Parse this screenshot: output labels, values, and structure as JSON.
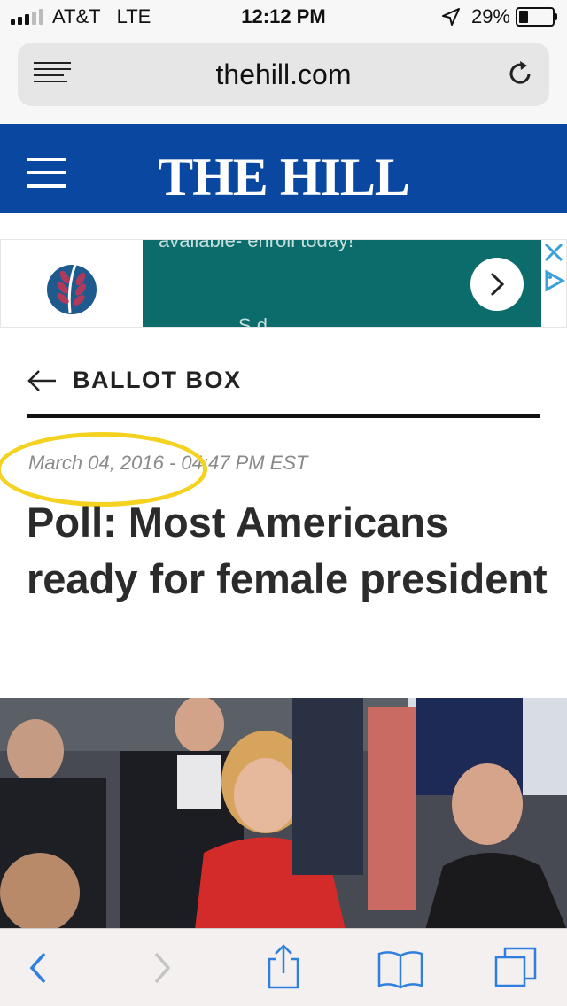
{
  "status_bar": {
    "carrier": "AT&T",
    "network": "LTE",
    "time": "12:12 PM",
    "battery_percent": "29%"
  },
  "browser": {
    "url": "thehill.com"
  },
  "site": {
    "logo_text": "THE HILL",
    "brand_color": "#0a47a0"
  },
  "ad": {
    "text_top": "available- enroll today!",
    "text_bottom": "S        d",
    "bg_color": "#0c6b6b"
  },
  "article": {
    "section": "BALLOT BOX",
    "date": "March 04, 2016 - 04:47 PM EST",
    "headline": "Poll: Most Americans ready for female president",
    "highlight_color": "#f4d21f"
  },
  "toolbar": {
    "icons": [
      "back-icon",
      "forward-icon",
      "share-icon",
      "bookmarks-icon",
      "tabs-icon"
    ]
  }
}
